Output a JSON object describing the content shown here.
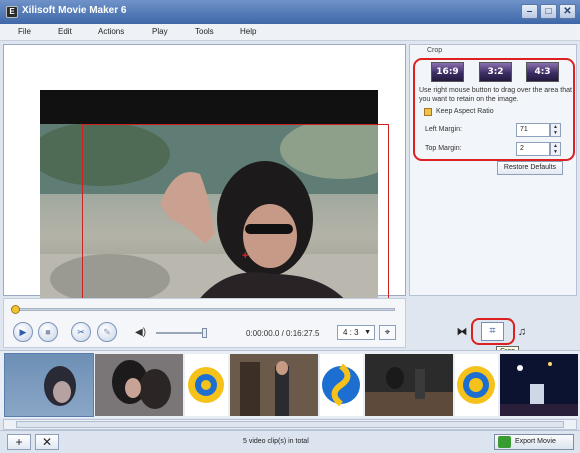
{
  "window": {
    "title": "Xilisoft Movie Maker 6",
    "app_icon_glyph": "E"
  },
  "menu": [
    "File",
    "Edit",
    "Actions",
    "Play",
    "Tools",
    "Help"
  ],
  "player": {
    "time": "0:00:00.0 / 0:16:27.5",
    "aspect_ratio": "4 : 3",
    "progress": 0.0
  },
  "crop_panel": {
    "group_label": "Crop",
    "presets": [
      "16:9",
      "3:2",
      "4:3"
    ],
    "instructions": "Use right mouse button to drag over the area that you want to retain on the image.",
    "keep_aspect_ratio_label": "Keep Aspect Ratio",
    "keep_aspect_ratio_checked": true,
    "left_margin_label": "Left Margin:",
    "left_margin_value": "71",
    "top_margin_label": "Top Margin:",
    "top_margin_value": "2",
    "restore_label": "Restore Defaults"
  },
  "tools": {
    "tooltip": "Crop"
  },
  "footer": {
    "clip_count": "5 video clip(s) in total",
    "export_label": "Export Movie"
  },
  "colors": {
    "highlight_red": "#dd2020",
    "titlebar_blue": "#3f67a8",
    "export_green": "#3a9b32"
  }
}
